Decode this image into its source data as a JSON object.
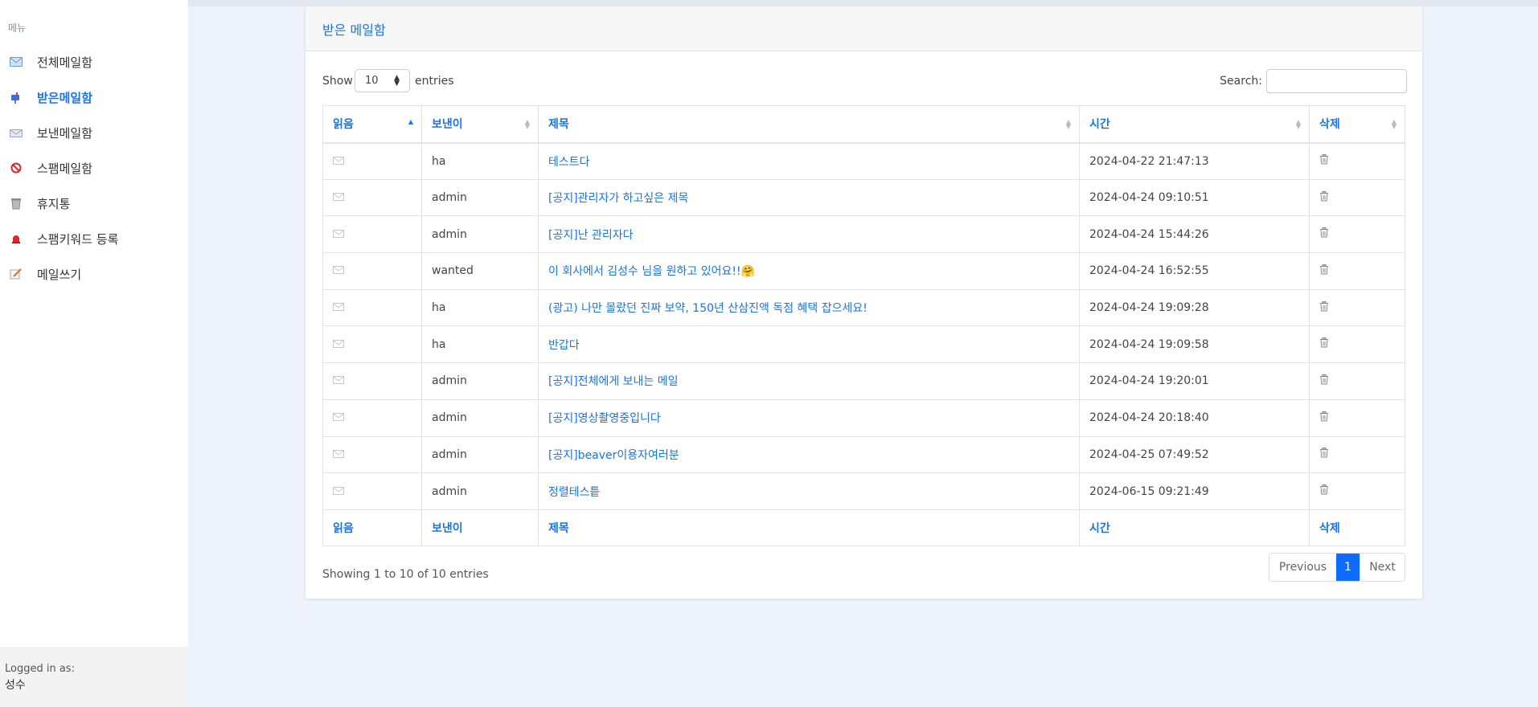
{
  "sidebar": {
    "menu_title": "메뉴",
    "items": [
      {
        "label": "전체메일함",
        "icon": "mailbox-icon",
        "active": false
      },
      {
        "label": "받은메일함",
        "icon": "inbox-icon",
        "active": true
      },
      {
        "label": "보낸메일함",
        "icon": "sent-icon",
        "active": false
      },
      {
        "label": "스팸메일함",
        "icon": "spam-icon",
        "active": false
      },
      {
        "label": "휴지통",
        "icon": "trash-bin-icon",
        "active": false
      },
      {
        "label": "스팸키워드 등록",
        "icon": "alarm-icon",
        "active": false
      },
      {
        "label": "메일쓰기",
        "icon": "compose-icon",
        "active": false
      }
    ],
    "logged_in_label": "Logged in as:",
    "logged_in_user": "성수"
  },
  "card": {
    "title": "받은 메일함"
  },
  "controls": {
    "show_label": "Show",
    "page_size": "10",
    "entries_label": "entries",
    "search_label": "Search:",
    "search_value": ""
  },
  "table": {
    "headers": {
      "read": "읽음",
      "sender": "보낸이",
      "subject": "제목",
      "time": "시간",
      "delete": "삭제"
    },
    "rows": [
      {
        "sender": "ha",
        "subject": "테스트다",
        "time": "2024-04-22 21:47:13"
      },
      {
        "sender": "admin",
        "subject": "[공지]관리자가 하고싶은 제목",
        "time": "2024-04-24 09:10:51"
      },
      {
        "sender": "admin",
        "subject": "[공지]난 관리자다",
        "time": "2024-04-24 15:44:26"
      },
      {
        "sender": "wanted",
        "subject": "이 회사에서 김성수 님을 원하고 있어요!!🤗",
        "time": "2024-04-24 16:52:55"
      },
      {
        "sender": "ha",
        "subject": "(광고) 나만 몰랐던 진짜 보약, 150년 산삼진액 독점 혜택 잡으세요!",
        "time": "2024-04-24 19:09:28"
      },
      {
        "sender": "ha",
        "subject": "반갑다",
        "time": "2024-04-24 19:09:58"
      },
      {
        "sender": "admin",
        "subject": "[공지]전체에게 보내는 메일",
        "time": "2024-04-24 19:20:01"
      },
      {
        "sender": "admin",
        "subject": "[공지]영상촬영중입니다",
        "time": "2024-04-24 20:18:40"
      },
      {
        "sender": "admin",
        "subject": "[공지]beaver이용자여러분",
        "time": "2024-04-25 07:49:52"
      },
      {
        "sender": "admin",
        "subject": "정렬테스틑",
        "time": "2024-06-15 09:21:49"
      }
    ]
  },
  "footer": {
    "info": "Showing 1 to 10 of 10 entries",
    "previous": "Previous",
    "current_page": "1",
    "next": "Next"
  },
  "colors": {
    "accent": "#1a73e8",
    "page_active": "#0d6efd",
    "background": "#eef2fb"
  }
}
